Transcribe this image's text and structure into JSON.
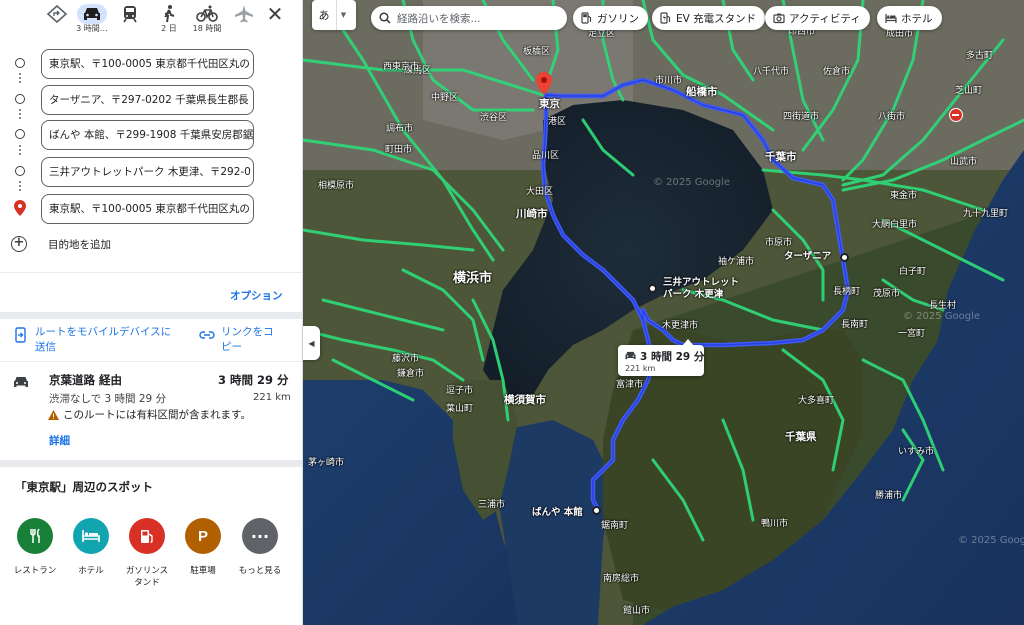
{
  "travel_modes": [
    {
      "name": "best",
      "label": ""
    },
    {
      "name": "car",
      "label": "3 時間…"
    },
    {
      "name": "transit",
      "label": ""
    },
    {
      "name": "walk",
      "label": "2 日"
    },
    {
      "name": "bike",
      "label": "18 時間"
    },
    {
      "name": "flight",
      "label": ""
    }
  ],
  "stops": [
    "東京駅、〒100-0005 東京都千代田区丸の",
    "ターザニア、〒297-0202 千葉県長生郡長",
    "ばんや 本館、〒299-1908 千葉県安房郡鋸",
    "三井アウトレットパーク 木更津、〒292-0",
    "東京駅、〒100-0005 東京都千代田区丸の"
  ],
  "add_destination": "目的地を追加",
  "options": "オプション",
  "share": {
    "send_to_mobile": "ルートをモバイルデバイスに送信",
    "send_line1": "ルートをモバイルデバイスに",
    "send_line2": "送信",
    "copy_line1": "リンクをコ",
    "copy_line2": "ピー"
  },
  "route": {
    "name": "京葉道路 経由",
    "time": "3 時間 29 分",
    "traffic": "渋滞なしで 3 時間 29 分",
    "distance": "221 km",
    "warning": "このルートには有料区間が含まれます。",
    "details": "詳細"
  },
  "nearby": {
    "title": "「東京駅」周辺のスポット",
    "items": [
      {
        "label": "レストラン",
        "color": "#188038",
        "icon": "restaurant-icon"
      },
      {
        "label": "ホテル",
        "color": "#12a4af",
        "icon": "hotel-icon"
      },
      {
        "label": "ガソリンス",
        "label2": "タンド",
        "color": "#d93025",
        "icon": "gas-station-icon"
      },
      {
        "label": "駐車場",
        "color": "#b06000",
        "icon": "parking-icon"
      },
      {
        "label": "もっと見る",
        "color": "#5f6368",
        "icon": "more-icon"
      }
    ]
  },
  "map": {
    "ime": "あ",
    "search_placeholder": "経路沿いを検索...",
    "chips": [
      "ガソリン",
      "EV 充電スタンド",
      "アクティビティ",
      "ホテル"
    ],
    "bubble_time": "3 時間 29 分",
    "bubble_distance": "221 km",
    "watermark": "© 2025 Google",
    "labels": {
      "tokyo": "東京",
      "chiba": "千葉市",
      "yokohama": "横浜市",
      "kawasaki": "川崎市",
      "funabashi": "船橋市",
      "yokosuka": "横須賀市",
      "chiba_pref": "千葉県",
      "minato": "港区",
      "shinagawa": "品川区",
      "ota": "大田区",
      "shibuya": "渋谷区",
      "itabashi": "板橋区",
      "adachi": "足立区",
      "ichikawa": "市川市",
      "sagamihara": "相模原市",
      "kisarazu": "木更津市",
      "futtsu": "富津市",
      "kyonan": "鋸南町",
      "minamiboso": "南房総市",
      "tateyama": "館山市",
      "kamogawa": "鴨川市",
      "katsuura": "勝浦市",
      "isumi": "いすみ市",
      "ichinomiya": "一宮町",
      "mobara": "茂原市",
      "nagara": "長柄町",
      "nanan": "長南町",
      "ichihara": "市原市",
      "otaki": "大多喜町",
      "miura": "三浦市",
      "hayama": "葉山町",
      "zushi": "逗子市",
      "kamakura": "鎌倉市",
      "fujisawa": "藤沢市",
      "chigasaki": "茅ヶ崎市",
      "togane": "東金市",
      "oami": "大網白里市",
      "kujukuri": "九十九里町",
      "shirako": "白子町",
      "chosei": "長生村",
      "yachimata": "八街市",
      "sakura": "佐倉市",
      "yotsukaido": "四街道市",
      "narita": "成田市",
      "inzai": "印西市",
      "tako": "多古町",
      "shibayama": "芝山町",
      "sammu": "山武市",
      "machida": "町田市",
      "chofu": "調布市",
      "nakano": "中野区",
      "nerima": "練馬区",
      "nishitokyo": "西東京市",
      "yachiyo": "八千代市",
      "sodegaura": "袖ケ浦市",
      "yokohama_ward": "横浜市"
    },
    "destinations": {
      "tarzania": "ターザニア",
      "outlet1": "三井アウトレット",
      "outlet2": "パーク 木更津",
      "banya": "ばんや 本館",
      "tokyo_station": "東京"
    }
  }
}
